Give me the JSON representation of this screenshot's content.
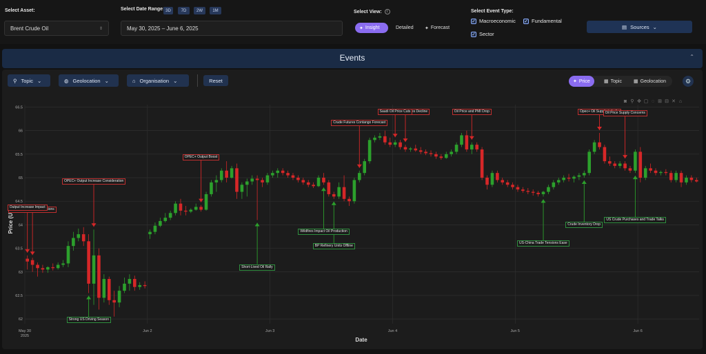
{
  "asset": {
    "label": "Select Asset:",
    "value": "Brent Crude Oil"
  },
  "date_range": {
    "label": "Select Date Range:",
    "buttons": [
      "3D",
      "7D",
      "2W",
      "1M"
    ],
    "value": "May 30, 2025 – June 6, 2025"
  },
  "view": {
    "label": "Select View:",
    "insight": "Insight",
    "detailed": "Detailed",
    "forecast": "Forecast",
    "active": "Insight"
  },
  "event_type": {
    "label": "Select Event Type:",
    "macroeconomic": "Macroeconomic",
    "fundamental": "Fundamental",
    "sector": "Sector",
    "checked": [
      true,
      true,
      true
    ]
  },
  "sources_button": "Sources",
  "events_header": "Events",
  "toolbar": {
    "topic": "Topic",
    "geolocation": "Geolocation",
    "organisation": "Organisation",
    "reset": "Reset"
  },
  "display_toggle": {
    "price": "Price",
    "topic": "Topic",
    "geolocation": "Geolocation",
    "active": "Price"
  },
  "colors": {
    "accent": "#8a6cf0",
    "up": "#2ca02c",
    "down": "#d62728",
    "panel": "#1a2b45"
  },
  "chart_data": {
    "type": "candlestick",
    "xlabel": "Date",
    "ylabel": "Price (US$)",
    "ylim": [
      61.9,
      66.55
    ],
    "y_ticks": [
      "62",
      "62.5",
      "63",
      "63.5",
      "64",
      "64.5",
      "65",
      "65.5",
      "66",
      "66.5"
    ],
    "x_ticks": [
      {
        "label": "May 30",
        "sub": "2025",
        "idx": 0
      },
      {
        "label": "Jun 2",
        "idx": 24
      },
      {
        "label": "Jun 3",
        "idx": 48
      },
      {
        "label": "Jun 4",
        "idx": 72
      },
      {
        "label": "Jun 5",
        "idx": 96
      },
      {
        "label": "Jun 6",
        "idx": 120
      }
    ],
    "candles": [
      {
        "o": 63.28,
        "h": 63.35,
        "l": 63.05,
        "c": 63.22
      },
      {
        "o": 63.25,
        "h": 63.3,
        "l": 63.0,
        "c": 63.15
      },
      {
        "o": 63.15,
        "h": 63.2,
        "l": 62.9,
        "c": 63.08
      },
      {
        "o": 63.08,
        "h": 63.15,
        "l": 62.98,
        "c": 63.05
      },
      {
        "o": 63.05,
        "h": 63.12,
        "l": 62.98,
        "c": 63.1
      },
      {
        "o": 63.1,
        "h": 63.18,
        "l": 63.03,
        "c": 63.08
      },
      {
        "o": 63.08,
        "h": 63.2,
        "l": 63.05,
        "c": 63.15
      },
      {
        "o": 63.15,
        "h": 63.25,
        "l": 63.1,
        "c": 63.18
      },
      {
        "o": 63.18,
        "h": 63.65,
        "l": 63.1,
        "c": 63.55
      },
      {
        "o": 63.55,
        "h": 63.85,
        "l": 63.45,
        "c": 63.72
      },
      {
        "o": 63.72,
        "h": 63.92,
        "l": 63.65,
        "c": 63.8
      },
      {
        "o": 63.8,
        "h": 63.95,
        "l": 63.55,
        "c": 63.65
      },
      {
        "o": 63.65,
        "h": 63.8,
        "l": 62.55,
        "c": 62.75
      },
      {
        "o": 62.75,
        "h": 63.9,
        "l": 62.3,
        "c": 63.35
      },
      {
        "o": 63.35,
        "h": 63.5,
        "l": 62.2,
        "c": 62.45
      },
      {
        "o": 62.45,
        "h": 62.95,
        "l": 62.35,
        "c": 62.85
      },
      {
        "o": 62.85,
        "h": 62.9,
        "l": 62.3,
        "c": 62.4
      },
      {
        "o": 62.4,
        "h": 62.6,
        "l": 62.05,
        "c": 62.35
      },
      {
        "o": 62.35,
        "h": 62.7,
        "l": 62.25,
        "c": 62.6
      },
      {
        "o": 62.6,
        "h": 62.88,
        "l": 62.55,
        "c": 62.75
      },
      {
        "o": 62.75,
        "h": 62.95,
        "l": 62.6,
        "c": 62.85
      },
      {
        "o": 62.85,
        "h": 62.92,
        "l": 62.6,
        "c": 62.68
      },
      {
        "o": 62.68,
        "h": 62.78,
        "l": 62.62,
        "c": 62.72
      },
      {
        "o": 62.72,
        "h": 62.8,
        "l": 62.65,
        "c": 62.7
      },
      {
        "o": 63.8,
        "h": 63.9,
        "l": 63.7,
        "c": 63.85
      },
      {
        "o": 63.85,
        "h": 64.05,
        "l": 63.8,
        "c": 63.98
      },
      {
        "o": 63.98,
        "h": 64.15,
        "l": 63.95,
        "c": 64.08
      },
      {
        "o": 64.08,
        "h": 64.25,
        "l": 64.05,
        "c": 64.15
      },
      {
        "o": 64.15,
        "h": 64.3,
        "l": 64.1,
        "c": 64.25
      },
      {
        "o": 64.25,
        "h": 64.5,
        "l": 64.2,
        "c": 64.45
      },
      {
        "o": 64.45,
        "h": 64.55,
        "l": 64.2,
        "c": 64.3
      },
      {
        "o": 64.3,
        "h": 64.4,
        "l": 64.2,
        "c": 64.28
      },
      {
        "o": 64.28,
        "h": 64.35,
        "l": 64.25,
        "c": 64.32
      },
      {
        "o": 64.32,
        "h": 64.45,
        "l": 64.3,
        "c": 64.38
      },
      {
        "o": 64.38,
        "h": 64.42,
        "l": 64.28,
        "c": 64.32
      },
      {
        "o": 64.32,
        "h": 64.7,
        "l": 64.3,
        "c": 64.65
      },
      {
        "o": 64.65,
        "h": 64.95,
        "l": 64.6,
        "c": 64.9
      },
      {
        "o": 64.9,
        "h": 65.05,
        "l": 64.7,
        "c": 64.95
      },
      {
        "o": 64.95,
        "h": 65.2,
        "l": 64.9,
        "c": 65.15
      },
      {
        "o": 65.15,
        "h": 65.35,
        "l": 64.9,
        "c": 65.0
      },
      {
        "o": 65.0,
        "h": 65.25,
        "l": 64.98,
        "c": 65.2
      },
      {
        "o": 65.2,
        "h": 65.3,
        "l": 64.55,
        "c": 64.7
      },
      {
        "o": 64.7,
        "h": 64.9,
        "l": 64.55,
        "c": 64.85
      },
      {
        "o": 64.85,
        "h": 64.98,
        "l": 64.6,
        "c": 64.92
      },
      {
        "o": 64.92,
        "h": 65.05,
        "l": 64.85,
        "c": 64.98
      },
      {
        "o": 64.98,
        "h": 65.05,
        "l": 64.1,
        "c": 64.95
      },
      {
        "o": 64.95,
        "h": 65.0,
        "l": 64.8,
        "c": 64.9
      },
      {
        "o": 64.9,
        "h": 65.1,
        "l": 64.85,
        "c": 65.05
      },
      {
        "o": 65.05,
        "h": 65.15,
        "l": 65.0,
        "c": 65.1
      },
      {
        "o": 65.1,
        "h": 65.2,
        "l": 65.0,
        "c": 65.15
      },
      {
        "o": 65.15,
        "h": 65.2,
        "l": 65.05,
        "c": 65.1
      },
      {
        "o": 65.1,
        "h": 65.15,
        "l": 65.0,
        "c": 65.05
      },
      {
        "o": 65.05,
        "h": 65.1,
        "l": 64.95,
        "c": 65.0
      },
      {
        "o": 65.0,
        "h": 65.05,
        "l": 64.9,
        "c": 64.95
      },
      {
        "o": 64.95,
        "h": 65.0,
        "l": 64.85,
        "c": 64.9
      },
      {
        "o": 64.9,
        "h": 64.95,
        "l": 64.8,
        "c": 64.85
      },
      {
        "o": 64.85,
        "h": 64.9,
        "l": 64.78,
        "c": 64.82
      },
      {
        "o": 64.82,
        "h": 65.05,
        "l": 64.8,
        "c": 65.0
      },
      {
        "o": 65.0,
        "h": 65.1,
        "l": 64.85,
        "c": 64.9
      },
      {
        "o": 64.9,
        "h": 64.95,
        "l": 64.6,
        "c": 64.65
      },
      {
        "o": 64.65,
        "h": 64.7,
        "l": 64.55,
        "c": 64.6
      },
      {
        "o": 64.6,
        "h": 64.9,
        "l": 64.55,
        "c": 64.8
      },
      {
        "o": 64.8,
        "h": 65.05,
        "l": 64.5,
        "c": 64.55
      },
      {
        "o": 64.55,
        "h": 64.6,
        "l": 64.4,
        "c": 64.5
      },
      {
        "o": 64.5,
        "h": 65.0,
        "l": 64.45,
        "c": 64.95
      },
      {
        "o": 64.95,
        "h": 65.15,
        "l": 64.9,
        "c": 65.1
      },
      {
        "o": 65.1,
        "h": 65.4,
        "l": 65.05,
        "c": 65.35
      },
      {
        "o": 65.35,
        "h": 65.85,
        "l": 65.3,
        "c": 65.8
      },
      {
        "o": 65.8,
        "h": 65.9,
        "l": 65.75,
        "c": 65.85
      },
      {
        "o": 65.85,
        "h": 65.95,
        "l": 65.8,
        "c": 65.88
      },
      {
        "o": 65.88,
        "h": 66.0,
        "l": 65.7,
        "c": 65.75
      },
      {
        "o": 65.75,
        "h": 65.85,
        "l": 65.65,
        "c": 65.7
      },
      {
        "o": 65.7,
        "h": 65.8,
        "l": 65.65,
        "c": 65.75
      },
      {
        "o": 65.75,
        "h": 65.8,
        "l": 65.6,
        "c": 65.65
      },
      {
        "o": 65.65,
        "h": 65.7,
        "l": 65.55,
        "c": 65.6
      },
      {
        "o": 65.6,
        "h": 65.65,
        "l": 65.55,
        "c": 65.62
      },
      {
        "o": 65.62,
        "h": 65.7,
        "l": 65.55,
        "c": 65.58
      },
      {
        "o": 65.58,
        "h": 65.65,
        "l": 65.5,
        "c": 65.55
      },
      {
        "o": 65.55,
        "h": 65.6,
        "l": 65.48,
        "c": 65.52
      },
      {
        "o": 65.52,
        "h": 65.58,
        "l": 65.45,
        "c": 65.5
      },
      {
        "o": 65.5,
        "h": 65.55,
        "l": 65.4,
        "c": 65.45
      },
      {
        "o": 65.45,
        "h": 65.5,
        "l": 65.38,
        "c": 65.42
      },
      {
        "o": 65.42,
        "h": 65.55,
        "l": 65.4,
        "c": 65.5
      },
      {
        "o": 65.5,
        "h": 65.6,
        "l": 65.45,
        "c": 65.55
      },
      {
        "o": 65.55,
        "h": 65.75,
        "l": 65.5,
        "c": 65.7
      },
      {
        "o": 65.7,
        "h": 65.95,
        "l": 65.65,
        "c": 65.9
      },
      {
        "o": 65.9,
        "h": 66.0,
        "l": 65.55,
        "c": 65.6
      },
      {
        "o": 65.6,
        "h": 65.75,
        "l": 65.5,
        "c": 65.7
      },
      {
        "o": 65.7,
        "h": 65.75,
        "l": 65.55,
        "c": 65.6
      },
      {
        "o": 65.6,
        "h": 65.65,
        "l": 64.95,
        "c": 65.0
      },
      {
        "o": 65.0,
        "h": 65.05,
        "l": 64.75,
        "c": 64.85
      },
      {
        "o": 64.85,
        "h": 65.15,
        "l": 64.8,
        "c": 65.1
      },
      {
        "o": 65.1,
        "h": 65.15,
        "l": 64.9,
        "c": 64.95
      },
      {
        "o": 64.95,
        "h": 65.0,
        "l": 64.85,
        "c": 64.9
      },
      {
        "o": 64.9,
        "h": 64.95,
        "l": 64.8,
        "c": 64.85
      },
      {
        "o": 64.85,
        "h": 64.9,
        "l": 64.75,
        "c": 64.8
      },
      {
        "o": 64.8,
        "h": 64.85,
        "l": 64.7,
        "c": 64.75
      },
      {
        "o": 64.75,
        "h": 64.8,
        "l": 64.68,
        "c": 64.72
      },
      {
        "o": 64.72,
        "h": 64.78,
        "l": 64.65,
        "c": 64.7
      },
      {
        "o": 64.7,
        "h": 64.75,
        "l": 64.62,
        "c": 64.68
      },
      {
        "o": 64.68,
        "h": 64.72,
        "l": 64.6,
        "c": 64.65
      },
      {
        "o": 64.65,
        "h": 64.72,
        "l": 64.6,
        "c": 64.7
      },
      {
        "o": 64.7,
        "h": 64.85,
        "l": 64.65,
        "c": 64.8
      },
      {
        "o": 64.8,
        "h": 64.95,
        "l": 64.75,
        "c": 64.9
      },
      {
        "o": 64.9,
        "h": 65.0,
        "l": 64.85,
        "c": 64.95
      },
      {
        "o": 64.95,
        "h": 65.05,
        "l": 64.9,
        "c": 65.0
      },
      {
        "o": 65.0,
        "h": 65.08,
        "l": 64.92,
        "c": 64.98
      },
      {
        "o": 64.98,
        "h": 65.05,
        "l": 64.9,
        "c": 65.02
      },
      {
        "o": 65.02,
        "h": 65.1,
        "l": 64.95,
        "c": 65.05
      },
      {
        "o": 65.05,
        "h": 65.15,
        "l": 65.0,
        "c": 65.1
      },
      {
        "o": 65.1,
        "h": 65.6,
        "l": 65.05,
        "c": 65.55
      },
      {
        "o": 65.55,
        "h": 65.8,
        "l": 65.5,
        "c": 65.75
      },
      {
        "o": 65.75,
        "h": 65.95,
        "l": 65.6,
        "c": 65.65
      },
      {
        "o": 65.65,
        "h": 65.7,
        "l": 65.3,
        "c": 65.35
      },
      {
        "o": 65.35,
        "h": 65.45,
        "l": 65.25,
        "c": 65.3
      },
      {
        "o": 65.3,
        "h": 65.35,
        "l": 65.2,
        "c": 65.25
      },
      {
        "o": 65.25,
        "h": 65.35,
        "l": 65.2,
        "c": 65.3
      },
      {
        "o": 65.3,
        "h": 65.35,
        "l": 65.15,
        "c": 65.2
      },
      {
        "o": 65.2,
        "h": 65.25,
        "l": 65.1,
        "c": 65.15
      },
      {
        "o": 65.15,
        "h": 65.6,
        "l": 65.1,
        "c": 65.55
      },
      {
        "o": 65.55,
        "h": 65.65,
        "l": 64.9,
        "c": 65.0
      },
      {
        "o": 65.0,
        "h": 65.25,
        "l": 64.95,
        "c": 65.2
      },
      {
        "o": 65.2,
        "h": 65.3,
        "l": 65.1,
        "c": 65.15
      },
      {
        "o": 65.15,
        "h": 65.2,
        "l": 65.05,
        "c": 65.1
      },
      {
        "o": 65.1,
        "h": 65.15,
        "l": 65.05,
        "c": 65.12
      },
      {
        "o": 65.12,
        "h": 65.18,
        "l": 65.05,
        "c": 65.1
      },
      {
        "o": 65.1,
        "h": 65.15,
        "l": 64.9,
        "c": 64.95
      },
      {
        "o": 64.95,
        "h": 65.15,
        "l": 64.9,
        "c": 65.1
      },
      {
        "o": 65.1,
        "h": 65.15,
        "l": 64.8,
        "c": 64.9
      },
      {
        "o": 64.9,
        "h": 65.05,
        "l": 64.85,
        "c": 65.0
      },
      {
        "o": 65.0,
        "h": 65.05,
        "l": 64.9,
        "c": 64.95
      },
      {
        "o": 64.95,
        "h": 65.0,
        "l": 64.9,
        "c": 64.92
      }
    ],
    "annotations": [
      {
        "text": "Output Increase Discussions",
        "dir": "down",
        "idx": 1
      },
      {
        "text": "Output Increase Impact",
        "dir": "down",
        "idx": 0
      },
      {
        "text": "OPEC+ Output Increase Consideration",
        "dir": "down",
        "idx": 13
      },
      {
        "text": "Strong US Driving Season",
        "dir": "up",
        "idx": 12
      },
      {
        "text": "OPEC+ Output Boost",
        "dir": "down",
        "idx": 34
      },
      {
        "text": "Short-Lived Oil Rally",
        "dir": "up",
        "idx": 45
      },
      {
        "text": "Wildfires Impact Oil Production",
        "dir": "up",
        "idx": 58
      },
      {
        "text": "BP Refinery Units Offline",
        "dir": "up",
        "idx": 60
      },
      {
        "text": "Crude Futures Contango Forecast",
        "dir": "down",
        "idx": 65
      },
      {
        "text": "US Crude Stockpiles Decline",
        "dir": "down",
        "idx": 74
      },
      {
        "text": "Saudi Oil Price Cuts",
        "dir": "down",
        "idx": 72
      },
      {
        "text": "Oil Price and PMI Drop",
        "dir": "down",
        "idx": 87
      },
      {
        "text": "US-China Trade Tensions Ease",
        "dir": "up",
        "idx": 101
      },
      {
        "text": "Crude Inventory Drop",
        "dir": "up",
        "idx": 109
      },
      {
        "text": "Opec+ Oil Supply to India",
        "dir": "down",
        "idx": 112
      },
      {
        "text": "Oil Price Supply Concerns",
        "dir": "down",
        "idx": 117
      },
      {
        "text": "US Crude Purchases and Trade Talks",
        "dir": "up",
        "idx": 119
      }
    ]
  }
}
